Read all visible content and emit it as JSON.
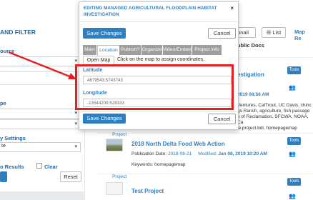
{
  "left_panel": {
    "title": "AND FILTER",
    "source_label": "ource",
    "type_label": "pe",
    "settings_label": "y Settings",
    "settings_value": "te",
    "results_label": "o Results",
    "clear_label": "Clear",
    "reset_label": "Reset"
  },
  "right_panel": {
    "thumbnail_view_label": "bnail",
    "list_view_label": "List",
    "map_results_label": "Map Re",
    "public_docs_label": "ublic Docs",
    "tools_label": "Tools",
    "items": [
      {
        "title_fragment": "estigation",
        "date_fragment": "2019 08:56 AM",
        "keywords_lines": [
          "Ventures, CalTrout, UC Davis, chinc",
          "gs Ranch, agriculture, fish passage",
          "u of Reclamation, SFCWA, NOAA, Ca",
          "le.project.bdl, homepagemap"
        ]
      }
    ]
  },
  "cards": [
    {
      "category": "Project",
      "title": "2018 North Delta Food Web Action",
      "publication_label": "Publication Date:",
      "publication_date": "2018-08-21",
      "modified_label": "Modified:",
      "modified_date": "Jan 08, 2019 10:20 AM",
      "keywords_label": "Keywords:",
      "keywords": "homepagemap"
    },
    {
      "category": "Project",
      "title": "Test Project"
    }
  ],
  "modal": {
    "title": "EDITING MANAGED AGRICULTURAL FLOODPLAIN HABITAT INVESTIGATION",
    "close_label": "×",
    "save_label": "Save Changes",
    "cancel_label": "Cancel",
    "tabs": [
      "Main",
      "Location",
      "Publish?",
      "Organize",
      "Video/Embed",
      "Project Info"
    ],
    "active_tab": "Location",
    "open_map_label": "Open Map",
    "map_hint": "Click on the map to assign coordinates.",
    "latitude_label": "Latitude",
    "latitude_value": "4679543.5743743",
    "longitude_label": "Longitude",
    "longitude_value": "-13544200.528333"
  },
  "colors": {
    "accent": "#2f7fbf",
    "highlight": "#e41f22",
    "tab_inactive": "#9e9e9e"
  }
}
